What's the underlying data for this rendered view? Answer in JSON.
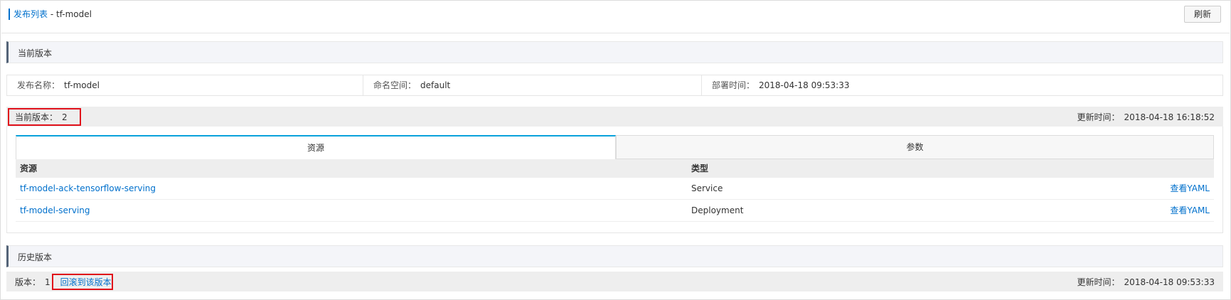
{
  "header": {
    "breadcrumb_link": "发布列表",
    "breadcrumb_sep": " - ",
    "breadcrumb_current": "tf-model",
    "refresh_label": "刷新"
  },
  "current_section": {
    "title": "当前版本"
  },
  "info": {
    "release_name_label": "发布名称：",
    "release_name": "tf-model",
    "namespace_label": "命名空间：",
    "namespace": "default",
    "deploy_time_label": "部署时间：",
    "deploy_time": "2018-04-18 09:53:33"
  },
  "current_version": {
    "label": "当前版本：",
    "value": "2",
    "updated_label": "更新时间：",
    "updated_value": "2018-04-18 16:18:52"
  },
  "tabs": [
    {
      "label": "资源",
      "active": true
    },
    {
      "label": "参数",
      "active": false
    }
  ],
  "table": {
    "headers": [
      "资源",
      "类型",
      ""
    ],
    "rows": [
      {
        "name": "tf-model-ack-tensorflow-serving",
        "type": "Service",
        "action": "查看YAML"
      },
      {
        "name": "tf-model-serving",
        "type": "Deployment",
        "action": "查看YAML"
      }
    ]
  },
  "history_section": {
    "title": "历史版本"
  },
  "history_version": {
    "label": "版本：",
    "value": "1",
    "rollback_label": "回滚到该版本",
    "updated_label": "更新时间：",
    "updated_value": "2018-04-18 09:53:33"
  },
  "colors": {
    "link": "#0070cc",
    "highlight_box": "#e0101a",
    "active_tab": "#0aa2db",
    "section_accent": "#546478"
  }
}
